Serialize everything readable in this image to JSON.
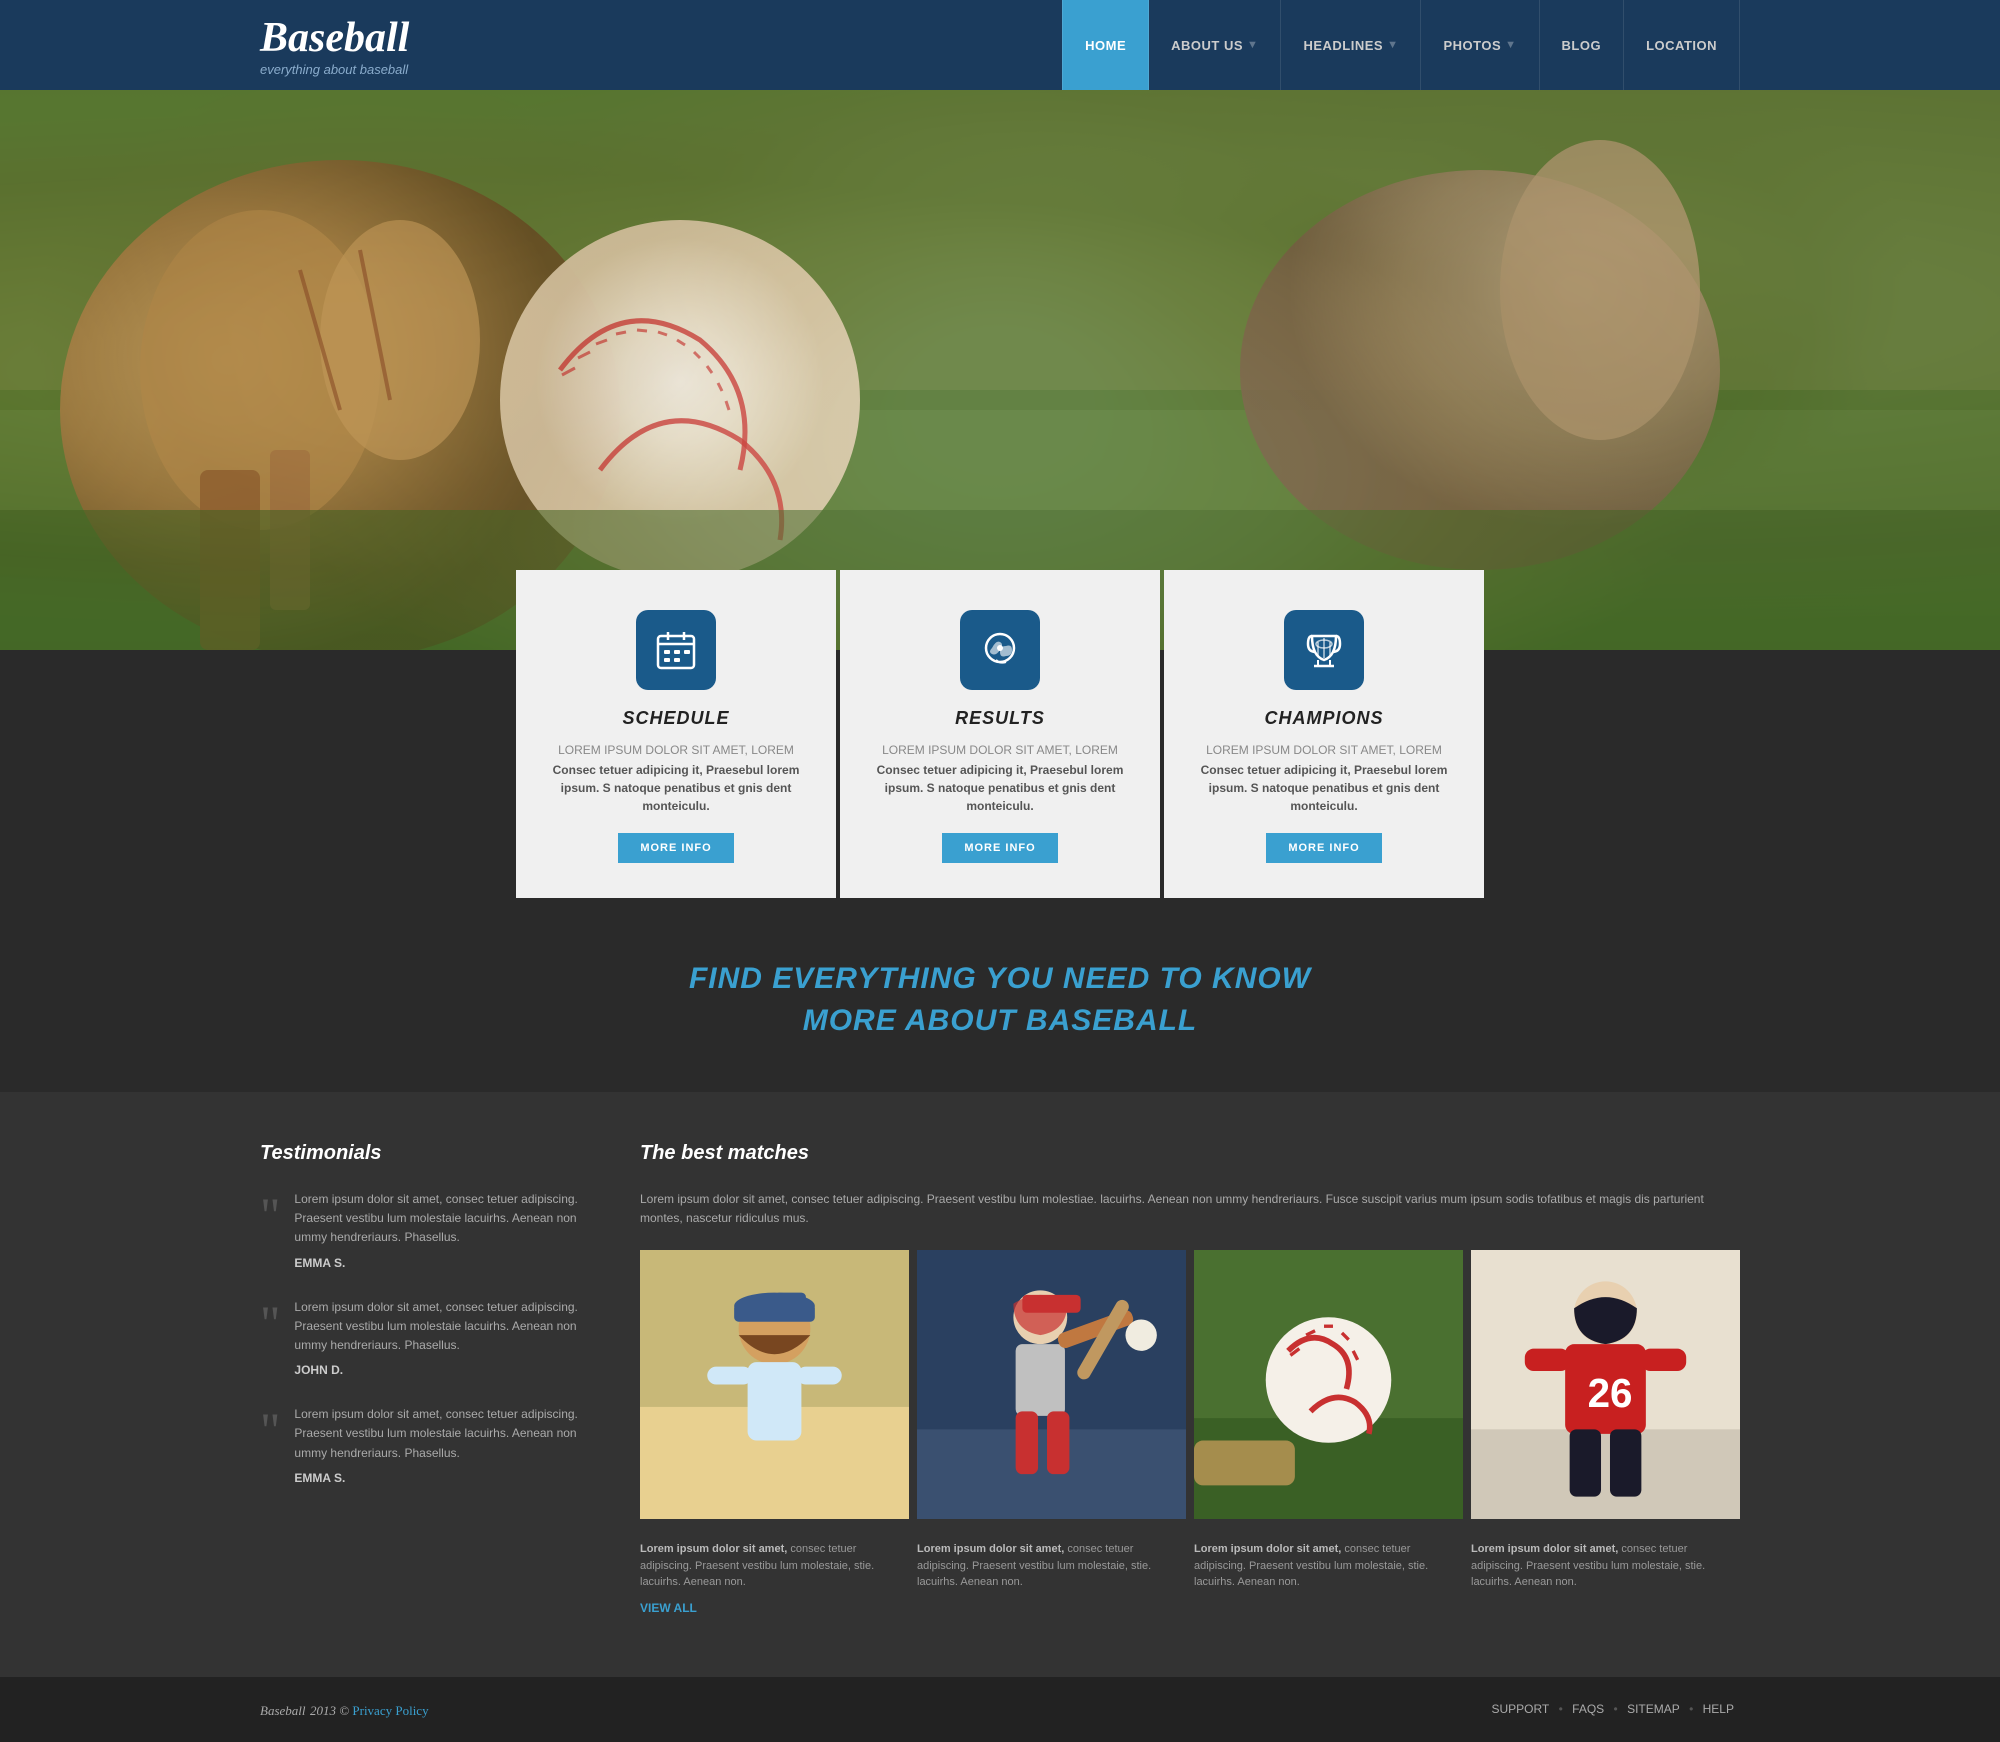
{
  "header": {
    "logo_title": "Baseball",
    "logo_subtitle": "everything about baseball",
    "nav": [
      {
        "label": "HOME",
        "active": true
      },
      {
        "label": "ABOUT US",
        "active": false,
        "has_sep": true
      },
      {
        "label": "HEADLINES",
        "active": false,
        "has_sep": true
      },
      {
        "label": "PHOTOS",
        "active": false,
        "has_sep": true
      },
      {
        "label": "BLOG",
        "active": false
      },
      {
        "label": "LOCATION",
        "active": false
      }
    ]
  },
  "cards": [
    {
      "icon": "schedule",
      "title": "SCHEDULE",
      "text_light": "LOREM IPSUM DOLOR SIT AMET, LOREM",
      "text_bold": "Consec tetuer adipicing it, Praesebul lorem ipsum. S natoque penatibus et gnis dent monteiculu.",
      "btn_label": "MORE INFO"
    },
    {
      "icon": "results",
      "title": "RESULTS",
      "text_light": "LOREM IPSUM DOLOR SIT AMET, LOREM",
      "text_bold": "Consec tetuer adipicing it, Praesebul lorem ipsum. S natoque penatibus et gnis dent monteiculu.",
      "btn_label": "MORE INFO"
    },
    {
      "icon": "champions",
      "title": "CHAMPIONS",
      "text_light": "LOREM IPSUM DOLOR SIT AMET, LOREM",
      "text_bold": "Consec tetuer adipicing it, Praesebul lorem ipsum. S natoque penatibus et gnis dent monteiculu.",
      "btn_label": "MORE INFO"
    }
  ],
  "tagline": {
    "line1": "FIND EVERYTHING YOU NEED TO KNOW",
    "line2": "MORE ABOUT BASEBALL"
  },
  "testimonials": {
    "heading": "Testimonials",
    "items": [
      {
        "text": "Lorem ipsum dolor sit amet, consec tetuer adipiscing. Praesent vestibu lum molestaie lacuirhs. Aenean non ummy hendreriaurs. Phasellus.",
        "author": "EMMA S."
      },
      {
        "text": "Lorem ipsum dolor sit amet, consec tetuer adipiscing. Praesent vestibu lum molestaie lacuirhs. Aenean non ummy hendreriaurs. Phasellus.",
        "author": "JOHN D."
      },
      {
        "text": "Lorem ipsum dolor sit amet, consec tetuer adipiscing. Praesent vestibu lum molestaie lacuirhs. Aenean non ummy hendreriaurs. Phasellus.",
        "author": "EMMA S."
      }
    ]
  },
  "matches": {
    "heading": "The best matches",
    "intro": "Lorem ipsum dolor sit amet, consec tetuer adipiscing. Praesent vestibu lum molestiae. lacuirhs. Aenean non ummy hendreriaurs. Fusce suscipit varius mum ipsum sodis tofatibus et magis dis parturient montes, nascetur ridiculus mus.",
    "items": [
      {
        "caption_bold": "Lorem ipsum dolor sit amet,",
        "caption": "consec tetuer adipiscing. Praesent vestibu lum molestaie, stie. lacuirhs. Aenean non."
      },
      {
        "caption_bold": "Lorem ipsum dolor sit amet,",
        "caption": "consec tetuer adipiscing. Praesent vestibu lum molestaie, stie. lacuirhs. Aenean non."
      },
      {
        "caption_bold": "Lorem ipsum dolor sit amet,",
        "caption": "consec tetuer adipiscing. Praesent vestibu lum molestaie, stie. lacuirhs. Aenean non."
      },
      {
        "caption_bold": "Lorem ipsum dolor sit amet,",
        "caption": "consec tetuer adipiscing. Praesent vestibu lum molestaie, stie. lacuirhs. Aenean non."
      }
    ],
    "view_all_label": "VIEW ALL"
  },
  "footer": {
    "logo": "Baseball",
    "copyright": " 2013 ©",
    "privacy_label": "Privacy Policy",
    "links": [
      "SUPPORT",
      "FAQS",
      "SITEMAP",
      "HELP"
    ]
  }
}
